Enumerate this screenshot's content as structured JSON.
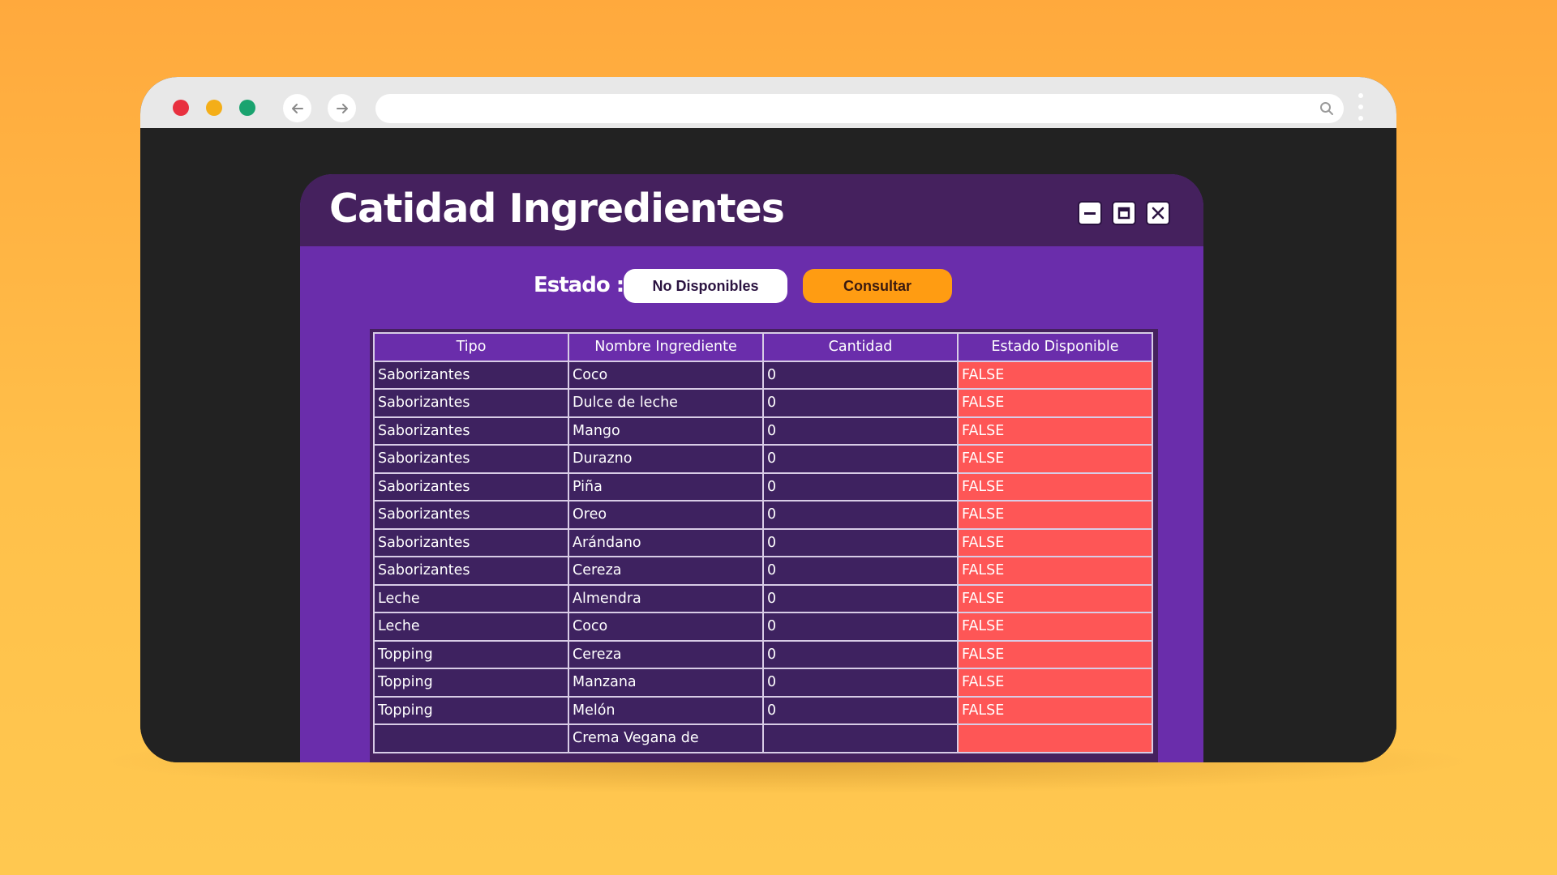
{
  "browser": {
    "url": ""
  },
  "app": {
    "title": "Catidad Ingredientes",
    "filter": {
      "label": "Estado :",
      "selected": "No Disponibles",
      "button": "Consultar"
    },
    "table": {
      "columns": [
        "Tipo",
        "Nombre Ingrediente",
        "Cantidad",
        "Estado Disponible"
      ],
      "rows": [
        [
          "Saborizantes",
          "Coco",
          "0",
          "FALSE"
        ],
        [
          "Saborizantes",
          "Dulce de leche",
          "0",
          "FALSE"
        ],
        [
          "Saborizantes",
          "Mango",
          "0",
          "FALSE"
        ],
        [
          "Saborizantes",
          "Durazno",
          "0",
          "FALSE"
        ],
        [
          "Saborizantes",
          "Piña",
          "0",
          "FALSE"
        ],
        [
          "Saborizantes",
          "Oreo",
          "0",
          "FALSE"
        ],
        [
          "Saborizantes",
          "Arándano",
          "0",
          "FALSE"
        ],
        [
          "Saborizantes",
          "Cereza",
          "0",
          "FALSE"
        ],
        [
          "Leche",
          "Almendra",
          "0",
          "FALSE"
        ],
        [
          "Leche",
          "Coco",
          "0",
          "FALSE"
        ],
        [
          "Topping",
          "Cereza",
          "0",
          "FALSE"
        ],
        [
          "Topping",
          "Manzana",
          "0",
          "FALSE"
        ],
        [
          "Topping",
          "Melón",
          "0",
          "FALSE"
        ],
        [
          "",
          "Crema Vegana de",
          "",
          ""
        ]
      ]
    }
  },
  "colors": {
    "background": "#ffb043",
    "app_panel": "#6a2dab",
    "title_bar": "#45215e",
    "false_cell": "#fe5656",
    "query_button": "#ff9c12"
  },
  "icons": {
    "nav_back": "arrow-left-icon",
    "nav_forward": "arrow-right-icon",
    "search": "search-icon",
    "menu": "kebab-menu-icon",
    "minimize": "minimize-icon",
    "maximize": "maximize-icon",
    "close": "close-icon"
  }
}
